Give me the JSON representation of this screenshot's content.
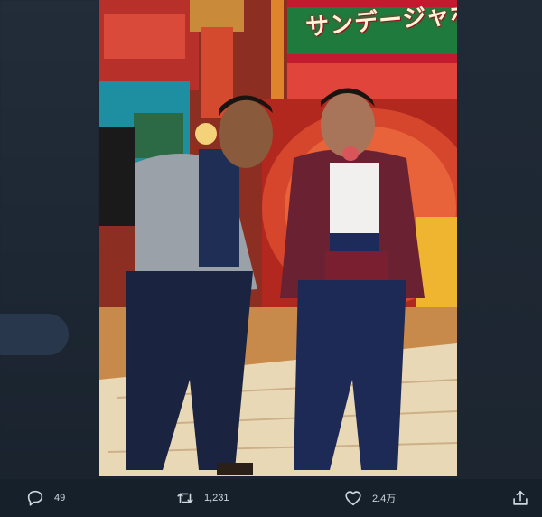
{
  "tweet": {
    "photo": {
      "sign_text": "サンデージャポ"
    },
    "actions": {
      "reply_count": "49",
      "retweet_count": "1,231",
      "like_count": "2.4万"
    }
  },
  "colors": {
    "background": "#15202b",
    "icon": "#cfd6dc"
  },
  "icons": {
    "reply": "reply-icon",
    "retweet": "retweet-icon",
    "like": "like-icon",
    "share": "share-icon"
  }
}
